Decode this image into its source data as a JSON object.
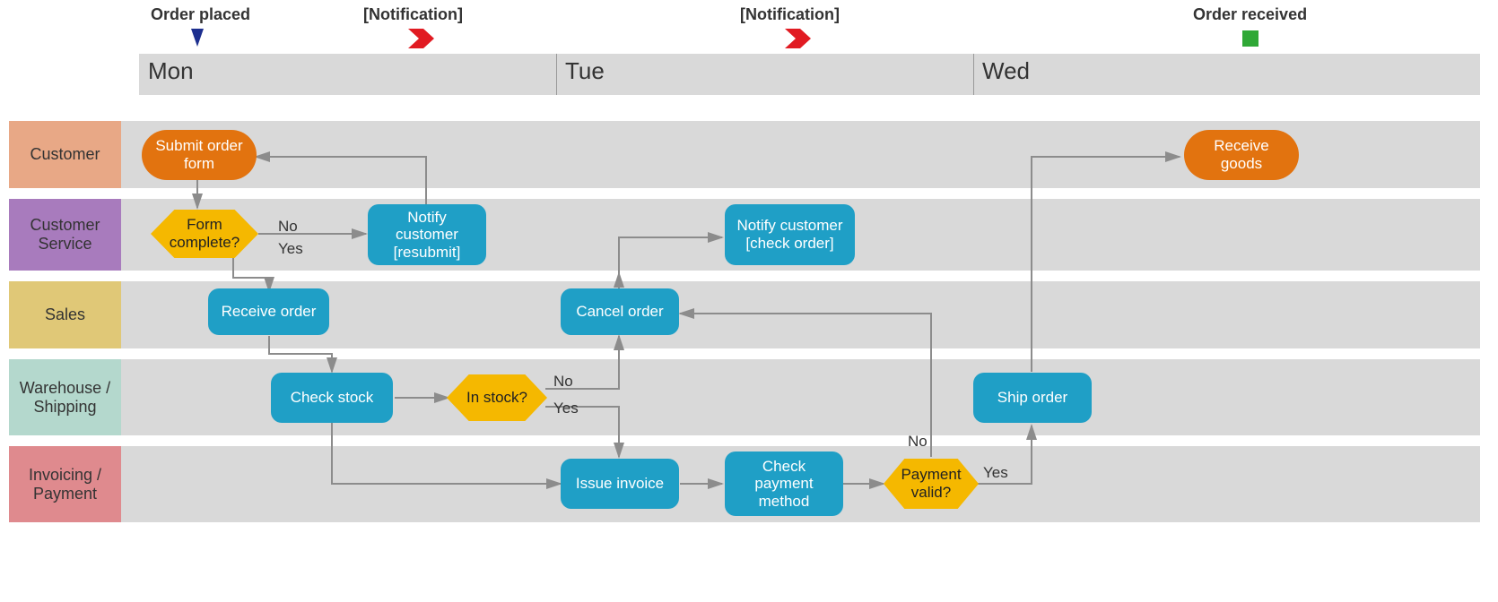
{
  "timeline": {
    "days": [
      "Mon",
      "Tue",
      "Wed"
    ],
    "milestones": [
      {
        "label": "Order placed",
        "kind": "start"
      },
      {
        "label": "[Notification]",
        "kind": "note"
      },
      {
        "label": "[Notification]",
        "kind": "note"
      },
      {
        "label": "Order received",
        "kind": "end"
      }
    ]
  },
  "lanes": [
    {
      "label": "Customer",
      "color": "#e8a886"
    },
    {
      "label": "Customer Service",
      "color": "#a87bbd"
    },
    {
      "label": "Sales",
      "color": "#e0c877"
    },
    {
      "label": "Warehouse / Shipping",
      "color": "#b4d8cd"
    },
    {
      "label": "Invoicing / Payment",
      "color": "#df8a8e"
    }
  ],
  "nodes": {
    "submit": "Submit order form",
    "receiveGoods": "Receive goods",
    "formComplete": "Form complete?",
    "notifyResubmit": "Notify customer [resubmit]",
    "notifyCheck": "Notify customer [check order]",
    "receiveOrder": "Receive order",
    "cancelOrder": "Cancel order",
    "checkStock": "Check stock",
    "inStock": "In stock?",
    "shipOrder": "Ship order",
    "issueInvoice": "Issue invoice",
    "checkPayment": "Check payment method",
    "paymentValid": "Payment valid?"
  },
  "edgeLabels": {
    "no": "No",
    "yes": "Yes"
  },
  "colors": {
    "process": "#1f9fc6",
    "terminator": "#e2730f",
    "decision": "#f5b800",
    "laneBg": "#d9d9d9",
    "arrow": "#8c8c8c",
    "startMarker": "#1d2f8f",
    "noteMarker": "#e11b22",
    "endMarker": "#2fa836"
  }
}
